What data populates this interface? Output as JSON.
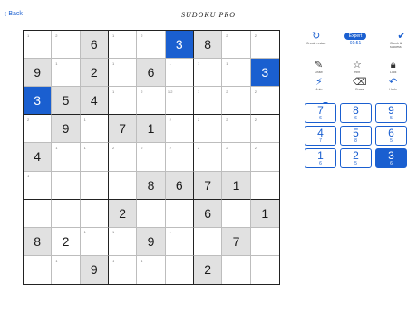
{
  "header": {
    "back_label": "Back",
    "title": "SUDOKU PRO"
  },
  "difficulty": "Expert",
  "timer": "01:51",
  "controls": {
    "restart": "Create restart",
    "check": "Check & success",
    "draw": "Draw",
    "hint": "Hint",
    "lock": "Lock",
    "auto": "Auto",
    "erase": "Erase",
    "undo": "Undo"
  },
  "selected_digit": "3",
  "numpad": [
    {
      "digit": "7",
      "count": "6"
    },
    {
      "digit": "8",
      "count": "6"
    },
    {
      "digit": "9",
      "count": "5"
    },
    {
      "digit": "4",
      "count": "7"
    },
    {
      "digit": "5",
      "count": "8"
    },
    {
      "digit": "6",
      "count": "5"
    },
    {
      "digit": "1",
      "count": "6"
    },
    {
      "digit": "2",
      "count": "5"
    },
    {
      "digit": "3",
      "count": "6"
    }
  ],
  "grid": [
    [
      {
        "n": "1"
      },
      {
        "n": "2"
      },
      {
        "v": "6",
        "g": 1
      },
      {
        "n": "1"
      },
      {
        "n": "2"
      },
      {
        "v": "3",
        "s": 1
      },
      {
        "v": "8",
        "g": 1
      },
      {
        "n": "2"
      },
      {
        "n": "2"
      }
    ],
    [
      {
        "v": "9",
        "g": 1
      },
      {
        "n": "1"
      },
      {
        "v": "2",
        "g": 1
      },
      {
        "n": "1"
      },
      {
        "v": "6",
        "g": 1
      },
      {
        "n": "1"
      },
      {
        "n": "1"
      },
      {
        "n": "1"
      },
      {
        "v": "3",
        "s": 1
      }
    ],
    [
      {
        "v": "3",
        "s": 1
      },
      {
        "v": "5",
        "g": 1
      },
      {
        "v": "4",
        "g": 1
      },
      {
        "n": "1"
      },
      {
        "n": "2"
      },
      {
        "n": "1 2"
      },
      {
        "n": "1"
      },
      {
        "n": "2"
      },
      {
        "n": "2"
      }
    ],
    [
      {
        "n": "2"
      },
      {
        "v": "9",
        "g": 1
      },
      {
        "n": "1"
      },
      {
        "v": "7",
        "g": 1
      },
      {
        "v": "1",
        "g": 1
      },
      {
        "n": "2"
      },
      {
        "n": "2"
      },
      {
        "n": "2"
      },
      {
        "n": "2"
      }
    ],
    [
      {
        "v": "4",
        "g": 1
      },
      {
        "n": "1"
      },
      {
        "n": "1"
      },
      {
        "n": "2"
      },
      {
        "n": "2"
      },
      {
        "n": "2"
      },
      {
        "n": "2"
      },
      {
        "n": "2"
      },
      {
        "n": "2"
      }
    ],
    [
      {
        "n": "1"
      },
      {
        "n": ""
      },
      {
        "n": ""
      },
      {
        "n": ""
      },
      {
        "v": "8",
        "g": 1
      },
      {
        "v": "6",
        "g": 1
      },
      {
        "v": "7",
        "g": 1
      },
      {
        "v": "1",
        "g": 1
      },
      {
        "n": ""
      }
    ],
    [
      {
        "n": ""
      },
      {
        "n": ""
      },
      {
        "n": ""
      },
      {
        "v": "2",
        "g": 1
      },
      {
        "n": ""
      },
      {
        "n": ""
      },
      {
        "v": "6",
        "g": 1
      },
      {
        "n": ""
      },
      {
        "v": "1",
        "g": 1
      }
    ],
    [
      {
        "v": "8",
        "g": 1
      },
      {
        "v": "2"
      },
      {
        "n": "1"
      },
      {
        "n": "1"
      },
      {
        "v": "9",
        "g": 1
      },
      {
        "n": "1"
      },
      {
        "n": ""
      },
      {
        "v": "7",
        "g": 1
      },
      {
        "n": ""
      }
    ],
    [
      {
        "n": ""
      },
      {
        "n": "1"
      },
      {
        "v": "9",
        "g": 1
      },
      {
        "n": "1"
      },
      {
        "n": "1"
      },
      {
        "n": ""
      },
      {
        "v": "2",
        "g": 1
      },
      {
        "n": ""
      },
      {
        "n": ""
      }
    ]
  ]
}
